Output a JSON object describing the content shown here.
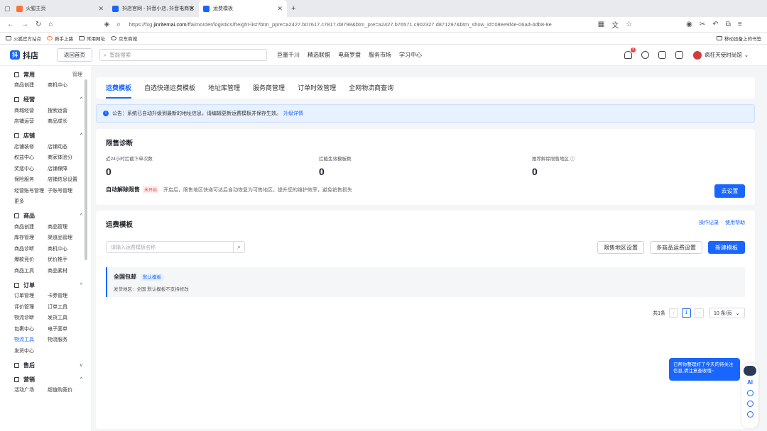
{
  "browser": {
    "tabs": [
      {
        "label": "火狐主页",
        "color": "#ff7139"
      },
      {
        "label": "抖店官网 - 抖音小店, 抖音电商官",
        "color": "#1966ff"
      },
      {
        "label": "运费模板",
        "color": "#1966ff"
      }
    ],
    "new_tab": "+",
    "url_prefix": "https://fxg.",
    "url_host": "jinritemai.com",
    "url_rest": "/ffa/morder/logistics/freight-list?btm_ppre=a2427.b07617.c7817.d8798&btm_pre=a2427.b76571.c902327.d871297&btm_show_id=08ee9f4e-06ad-4db8-8e",
    "bookmarks": [
      "火狐官方站点",
      "新手上路",
      "常用网址",
      "京东商城"
    ],
    "mobile_bookmarks": "移动设备上的书签"
  },
  "header": {
    "logo": "抖店",
    "logo_mark": "抖",
    "back_home": "返回首页",
    "search_placeholder": "智能搜索",
    "nav": [
      "巨量千川",
      "精选联盟",
      "电商罗盘",
      "服务市场",
      "学习中心"
    ],
    "notif_count": "5",
    "user": "疯狂天使时尚馆"
  },
  "sidebar": {
    "groups": [
      {
        "title": "常用",
        "right": "管理",
        "items": [
          "商品创建",
          "商机中心"
        ]
      },
      {
        "title": "经营",
        "right": "^",
        "items": [
          "商城经营",
          "搜索运营",
          "店铺运营",
          "商品成长"
        ]
      },
      {
        "title": "店铺",
        "right": "^",
        "items": [
          "店铺装修",
          "店铺动态",
          "权益中心",
          "商家体验分",
          "奖惩中心",
          "店铺保障",
          "保险服务",
          "店铺信息设置",
          "经营账号管理",
          "子账号管理",
          "更多"
        ]
      },
      {
        "title": "商品",
        "right": "^",
        "items": [
          "商品创建",
          "商品管理",
          "库存管理",
          "渠道品管理",
          "商品诊断",
          "商机中心",
          "爆款竞价",
          "优价推手",
          "商品工具",
          "商品素材"
        ]
      },
      {
        "title": "订单",
        "right": "^",
        "items": [
          "订单管理",
          "卡券管理",
          "评价管理",
          "订单工具",
          "物流诊断",
          "发货工具",
          "包裹中心",
          "电子面单",
          "物流工具",
          "物流服务",
          "发货中心"
        ]
      },
      {
        "title": "售后",
        "right": "v",
        "items": []
      },
      {
        "title": "营销",
        "right": "^",
        "items": [
          "活动广场",
          "超值购竞价"
        ]
      }
    ]
  },
  "main": {
    "tabs": [
      "运费模板",
      "自选快递运费模板",
      "地址库管理",
      "服务商管理",
      "订单时效管理",
      "全网物流商查询"
    ],
    "notice": "公告：系统已自动升级到最新的地址信息，请编辑更新运费模板并保存生效。",
    "notice_link": "升级详情",
    "diag": {
      "title": "限售诊断",
      "stats": [
        {
          "label": "近24小时拦截下单次数",
          "value": "0"
        },
        {
          "label": "拦截生效模板数",
          "value": "0"
        },
        {
          "label": "推荐解除限售地区 ⓘ",
          "value": "0"
        }
      ],
      "auto_label": "自动解除限售",
      "auto_tag": "未开启",
      "auto_desc": "开启后，限售地区快递可达后自动恢复为可售地区，提升您的维护效率，避免销售损失",
      "button": "去设置"
    },
    "tpl": {
      "title": "运费模板",
      "links": [
        "操作记录",
        "使用帮助"
      ],
      "search_placeholder": "请输入运费模板名称",
      "buttons": [
        "限售地区设置",
        "多商品运费设置",
        "新建模板"
      ],
      "item_name": "全国包邮",
      "item_tag": "默认模板",
      "item_sub": "发货地区：全国    默认模板不支持修改",
      "total": "共1条",
      "page": "1",
      "page_size": "10 条/页"
    }
  },
  "assistant": {
    "text": "已帮你整理好了今天的待关注信息,请注意查收哦~",
    "ai": "AI"
  }
}
